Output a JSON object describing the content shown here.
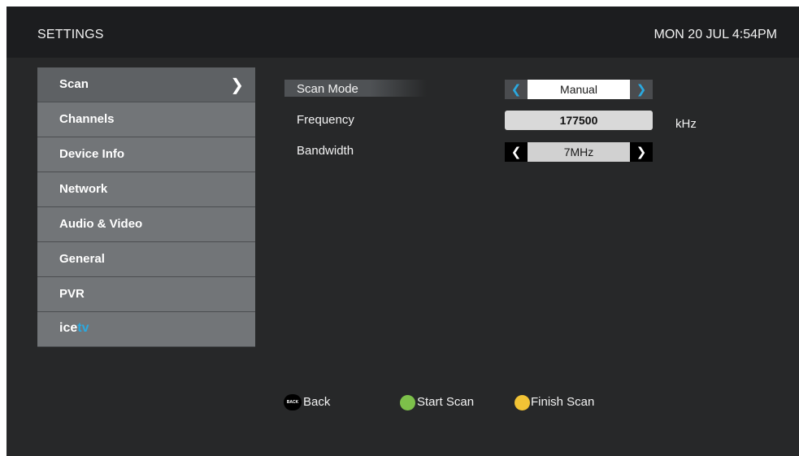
{
  "header": {
    "title": "SETTINGS",
    "datetime": "MON 20 JUL 4:54PM"
  },
  "menu": {
    "items": [
      {
        "label": "Scan",
        "selected": true,
        "arrow": "chevron-right-icon"
      },
      {
        "label": "Channels"
      },
      {
        "label": "Device Info"
      },
      {
        "label": "Network"
      },
      {
        "label": "Audio & Video"
      },
      {
        "label": "General"
      },
      {
        "label": "PVR"
      }
    ],
    "logo": {
      "ice": "ice",
      "tv": "tv"
    }
  },
  "scan": {
    "scan_mode": {
      "label": "Scan Mode",
      "value": "Manual"
    },
    "frequency": {
      "label": "Frequency",
      "value": "177500",
      "unit": "kHz"
    },
    "bandwidth": {
      "label": "Bandwidth",
      "value": "7MHz"
    }
  },
  "footer": {
    "back": {
      "badge": "BACK",
      "label": "Back"
    },
    "start": {
      "label": "Start Scan",
      "color": "#7dc04a"
    },
    "finish": {
      "label": "Finish Scan",
      "color": "#f2c335"
    }
  },
  "colors": {
    "accent": "#2aa9e0",
    "menu_bg": "#727578",
    "screen_bg": "#272829"
  }
}
